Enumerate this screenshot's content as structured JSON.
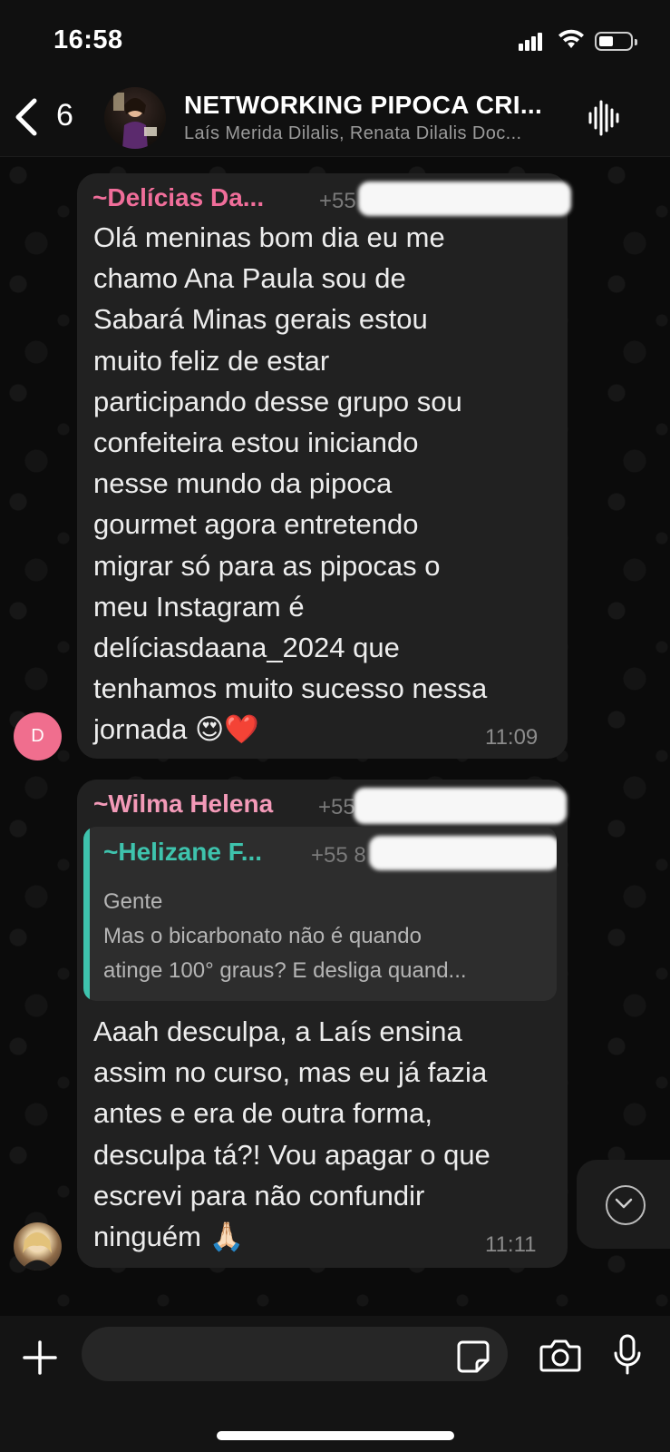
{
  "status": {
    "time": "16:58"
  },
  "header": {
    "back_count": "6",
    "title": "NETWORKING PIPOCA CRI...",
    "subtitle": "Laís Merida Dilalis, Renata Dilalis Doc..."
  },
  "messages": [
    {
      "sender": "~Delícias Da...",
      "sender_color": "#f06e9a",
      "phone": "+55",
      "avatar_letter": "D",
      "avatar_color": "#f06e8e",
      "text": "Olá meninas bom dia eu me\nchamo Ana Paula sou de\nSabará Minas gerais estou\nmuito feliz de estar\nparticipando desse grupo sou\nconfeiteira estou iniciando\nnesse mundo da pipoca\ngourmet agora entretendo\nmigrar só para as pipocas o\nmeu Instagram é\ndelíciasdaana_2024 que\ntenhamos muito sucesso nessa\njornada 😍❤️",
      "time": "11:09"
    },
    {
      "sender": "~Wilma Helena",
      "sender_color": "#f39ab8",
      "phone": "+55",
      "quoted": {
        "sender": "~Helizane F...",
        "phone": "+55 8",
        "line1": "Gente",
        "line2": "Mas o bicarbonato não é quando",
        "line3": "atinge 100° graus? E desliga quand..."
      },
      "text": "Aaah desculpa, a Laís ensina\nassim no curso, mas eu já fazia\nantes e era de outra forma,\ndesculpa tá?! Vou apagar o que\nescrevi para não confundir\nninguém 🙏🏻",
      "time": "11:11"
    }
  ],
  "colors": {
    "accent_teal": "#3ec3ad",
    "bubble": "#212121",
    "background": "#0b0b0b"
  },
  "icons": [
    "chevron-left-icon",
    "waveform-icon",
    "plus-icon",
    "sticker-icon",
    "camera-icon",
    "microphone-icon",
    "chevron-down-icon"
  ]
}
